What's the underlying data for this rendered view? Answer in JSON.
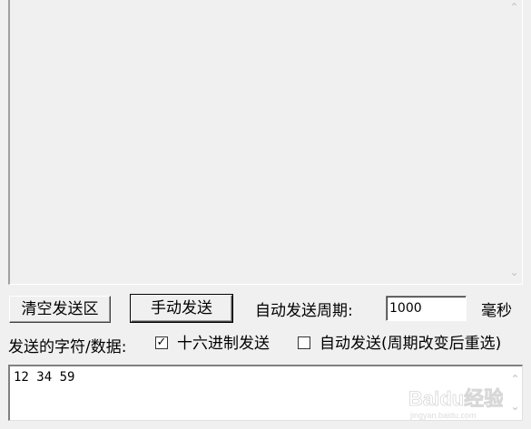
{
  "receive_area": {
    "content": ""
  },
  "buttons": {
    "clear_send": "清空发送区",
    "manual_send": "手动发送"
  },
  "auto_period": {
    "label": "自动发送周期:",
    "value": "1000",
    "unit": "毫秒"
  },
  "send_section": {
    "label": "发送的字符/数据:",
    "hex_send_label": "十六进制发送",
    "hex_send_checked": true,
    "auto_send_label": "自动发送(周期改变后重选)",
    "auto_send_checked": false
  },
  "send_area": {
    "content": "12 34 59"
  },
  "watermark": {
    "text": "Baidu经验",
    "subtext": "jingyan.baidu.com"
  },
  "icons": {
    "scroll_up": "scroll-up-arrow-icon",
    "scroll_down": "scroll-down-arrow-icon",
    "check": "checkmark-icon"
  }
}
